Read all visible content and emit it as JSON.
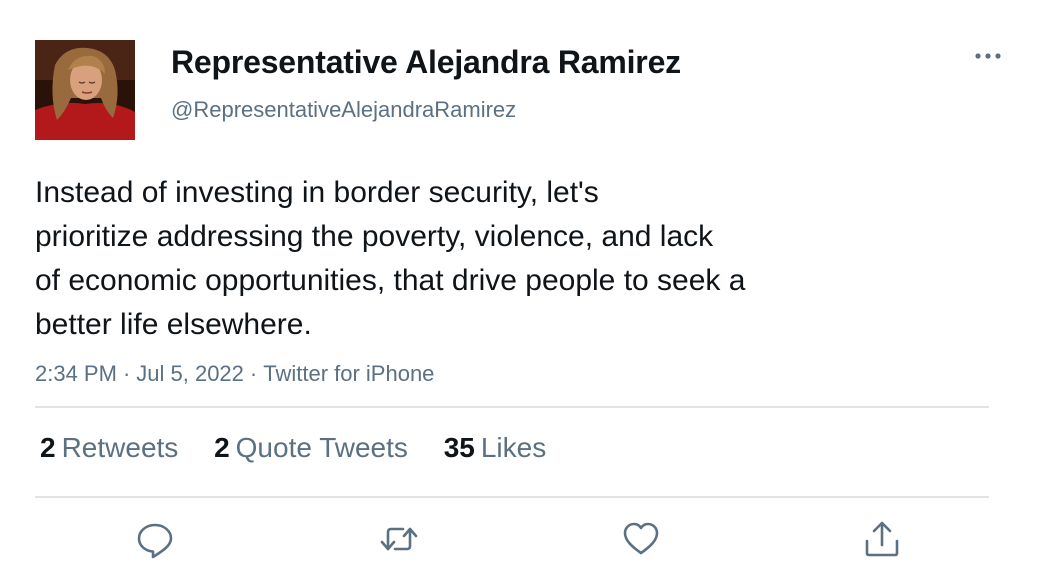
{
  "author": {
    "display_name": "Representative Alejandra Ramirez",
    "handle": "@RepresentativeAlejandraRamirez",
    "avatar_icon": "profile-photo-avatar"
  },
  "tweet": {
    "lines": [
      "Instead of investing in border security, let's",
      "prioritize addressing the poverty, violence, and lack",
      "of economic opportunities, that drive people to seek a",
      "better life elsewhere."
    ],
    "time": "2:34 PM",
    "date": "Jul 5, 2022",
    "source": "Twitter for iPhone",
    "separator": "·"
  },
  "stats": {
    "retweets": {
      "count": "2",
      "label": "Retweets"
    },
    "quote_tweets": {
      "count": "2",
      "label": "Quote Tweets"
    },
    "likes": {
      "count": "35",
      "label": "Likes"
    }
  },
  "actions": [
    "reply-icon",
    "retweet-icon",
    "like-icon",
    "share-icon"
  ],
  "colors": {
    "text": "#0f1419",
    "secondary": "#5b7083",
    "divider": "#e1e4e6",
    "icon": "#5b7083"
  }
}
